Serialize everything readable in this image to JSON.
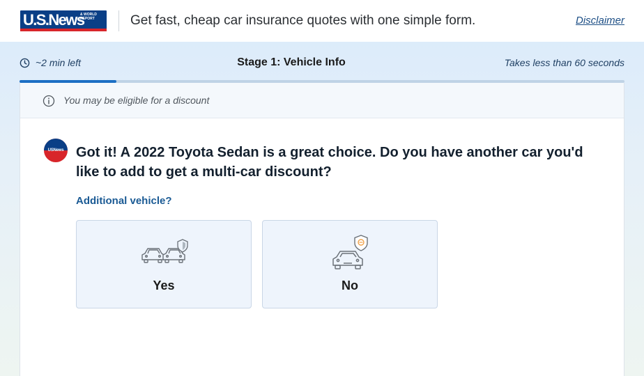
{
  "header": {
    "logo_text": "U.S.News",
    "logo_small_text": "& WORLD REPORT",
    "tagline": "Get fast, cheap car insurance quotes with one simple form.",
    "disclaimer_label": "Disclaimer"
  },
  "progress": {
    "time_left": "~2 min left",
    "stage_title": "Stage 1: Vehicle Info",
    "takes_text": "Takes less than 60 seconds",
    "completed_fraction": 0.16
  },
  "discount_notice": "You may be eligible for a discount",
  "avatar_text": "USNews",
  "question": "Got it! A 2022 Toyota Sedan is a great choice. Do you have another car you'd like to add to get a multi-car discount?",
  "field_label": "Additional vehicle?",
  "options": [
    {
      "label": "Yes",
      "icon": "two-cars-shield-icon"
    },
    {
      "label": "No",
      "icon": "single-car-shield-icon"
    }
  ],
  "colors": {
    "brand_navy": "#0a3f86",
    "brand_red": "#d8252a",
    "progress_fill": "#1c6fc4",
    "option_bg": "#eef4fc",
    "shield_accent": "#f0a24a"
  }
}
